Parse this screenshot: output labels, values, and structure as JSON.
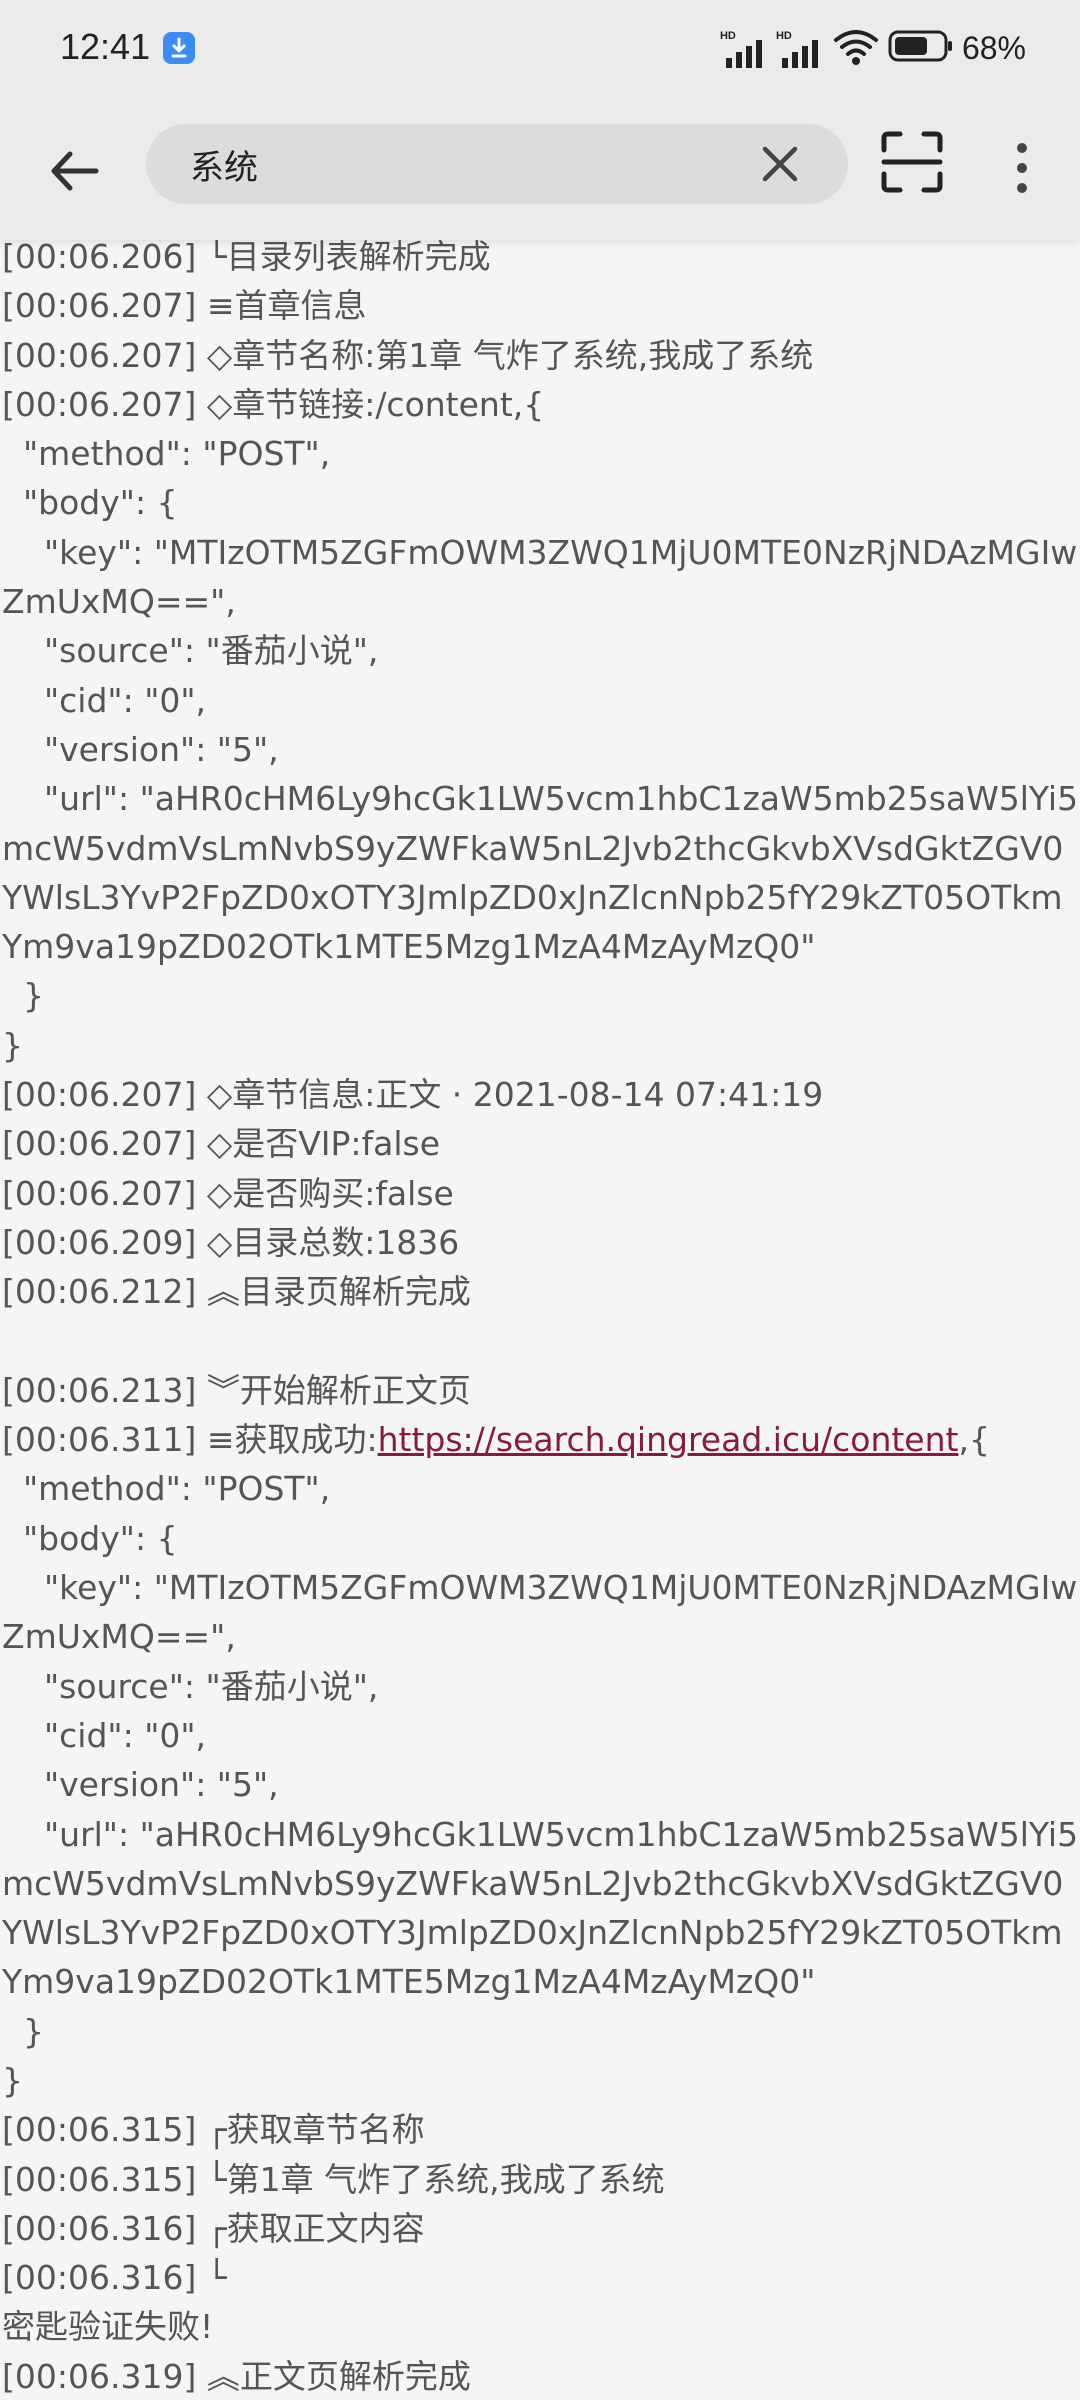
{
  "status_bar": {
    "time": "12:41",
    "network_label_1": "HD",
    "network_label_2": "HD",
    "battery_percent": "68%",
    "icons": [
      "download-icon",
      "signal-icon",
      "signal-icon",
      "wifi-icon",
      "battery-icon"
    ]
  },
  "app_bar": {
    "back_icon": "arrow-left-icon",
    "search_value": "系统",
    "clear_icon": "close-icon",
    "scan_icon": "scan-frame-icon",
    "more_icon": "more-vertical-icon"
  },
  "log": {
    "before_link": "[00:06.206] └目录列表解析完成\n[00:06.207] ≡首章信息\n[00:06.207] ◇章节名称:第1章 气炸了系统,我成了系统\n[00:06.207] ◇章节链接:/content,{\n  \"method\": \"POST\",\n  \"body\": {\n    \"key\": \"MTIzOTM5ZGFmOWM3ZWQ1MjU0MTE0NzRjNDAzMGIwZmUxMQ==\",\n    \"source\": \"番茄小说\",\n    \"cid\": \"0\",\n    \"version\": \"5\",\n    \"url\": \"aHR0cHM6Ly9hcGk1LW5vcm1hbC1zaW5mb25saW5lYi5mcW5vdmVsLmNvbS9yZWFkaW5nL2Jvb2thcGkvbXVsdGktZGV0YWlsL3YvP2FpZD0xOTY3JmlpZD0xJnZlcnNpb25fY29kZT05OTkmYm9va19pZD02OTk1MTE5Mzg1MzA4MzAyMzQ0\"\n  }\n}\n[00:06.207] ◇章节信息:正文 · 2021-08-14 07:41:19\n[00:06.207] ◇是否VIP:false\n[00:06.207] ◇是否购买:false\n[00:06.209] ◇目录总数:1836\n[00:06.212] ︽目录页解析完成\n\n[00:06.213] ︾开始解析正文页\n[00:06.311] ≡获取成功:",
    "link_text": "https://search.qingread.icu/content",
    "after_link": ",{\n  \"method\": \"POST\",\n  \"body\": {\n    \"key\": \"MTIzOTM5ZGFmOWM3ZWQ1MjU0MTE0NzRjNDAzMGIwZmUxMQ==\",\n    \"source\": \"番茄小说\",\n    \"cid\": \"0\",\n    \"version\": \"5\",\n    \"url\": \"aHR0cHM6Ly9hcGk1LW5vcm1hbC1zaW5mb25saW5lYi5mcW5vdmVsLmNvbS9yZWFkaW5nL2Jvb2thcGkvbXVsdGktZGV0YWlsL3YvP2FpZD0xOTY3JmlpZD0xJnZlcnNpb25fY29kZT05OTkmYm9va19pZD02OTk1MTE5Mzg1MzA4MzAyMzQ0\"\n  }\n}\n[00:06.315] ┌获取章节名称\n[00:06.315] └第1章 气炸了系统,我成了系统\n[00:06.316] ┌获取正文内容\n[00:06.316] └\n密匙验证失败!\n[00:06.319] ︽正文页解析完成"
  },
  "colors": {
    "background": "#f5f5f5",
    "app_bar": "#ebebeb",
    "search_pill": "#dcdcdc",
    "log_text": "#555555",
    "link": "#8a1a3c",
    "download_badge": "#3d8bf5"
  }
}
